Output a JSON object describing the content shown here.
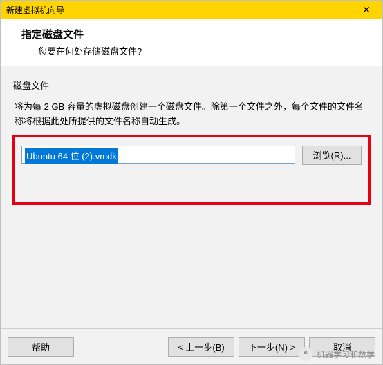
{
  "titlebar": {
    "title": "新建虚拟机向导"
  },
  "header": {
    "heading": "指定磁盘文件",
    "subheading": "您要在何处存储磁盘文件?"
  },
  "content": {
    "group_label": "磁盘文件",
    "description": "将为每 2 GB 容量的虚拟磁盘创建一个磁盘文件。除第一个文件之外，每个文件的文件名称将根据此处所提供的文件名称自动生成。",
    "filename_value": "Ubuntu 64 位 (2).vmdk",
    "browse_label": "浏览(R)..."
  },
  "footer": {
    "help_label": "帮助",
    "back_label": "< 上一步(B)",
    "next_label": "下一步(N) >",
    "cancel_label": "取消"
  },
  "watermark": {
    "text": "机器学习和数学"
  }
}
